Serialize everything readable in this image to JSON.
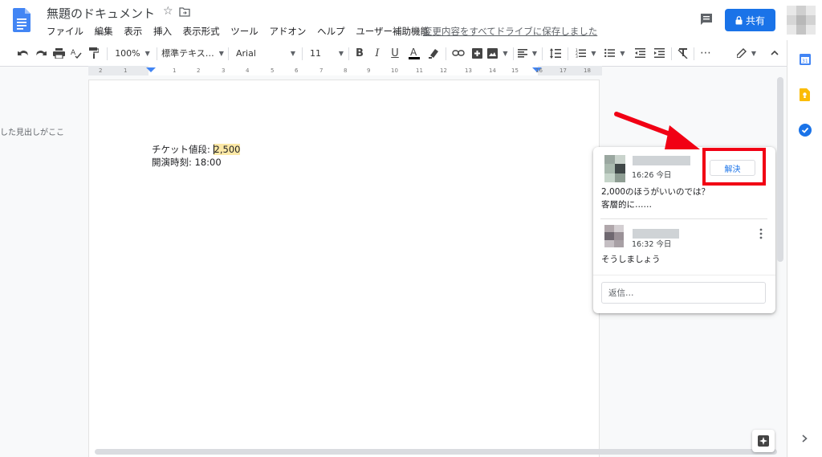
{
  "header": {
    "doc_title": "無題のドキュメント",
    "star_glyph": "☆",
    "menus": [
      "ファイル",
      "編集",
      "表示",
      "挿入",
      "表示形式",
      "ツール",
      "アドオン",
      "ヘルプ",
      "ユーザー補助機能"
    ],
    "save_status": "変更内容をすべてドライブに保存しました",
    "share_label": "共有"
  },
  "toolbar": {
    "zoom": "100%",
    "style": "標準テキス…",
    "font": "Arial",
    "size": "11",
    "more": "⋯"
  },
  "ruler": {
    "labels": [
      "2",
      "1",
      "1",
      "2",
      "3",
      "4",
      "5",
      "6",
      "7",
      "8",
      "9",
      "10",
      "11",
      "12",
      "13",
      "14",
      "15",
      "16",
      "17",
      "18"
    ]
  },
  "outline": {
    "text": "した見出しがここ"
  },
  "document": {
    "line1_label": "チケット値段: ",
    "line1_value": "2,500",
    "line2": "開演時刻: 18:00"
  },
  "comment": {
    "first": {
      "time": "16:26 今日",
      "text_line1": "2,000のほうがいいのでは？",
      "text_line2": "客層的に……"
    },
    "resolve_label": "解決",
    "reply": {
      "time": "16:32 今日",
      "text": "そうしましょう"
    },
    "reply_placeholder": "返信…"
  },
  "colors": {
    "accent": "#1a73e8",
    "highlight": "#fce8a6",
    "annotation_red": "#f10014"
  },
  "icons": [
    "docs-logo",
    "star-icon",
    "folder-move-icon",
    "comments-icon",
    "lock-icon",
    "undo-icon",
    "redo-icon",
    "print-icon",
    "spellcheck-icon",
    "paint-format-icon",
    "bold-icon",
    "italic-icon",
    "underline-icon",
    "text-color-icon",
    "highlight-icon",
    "link-icon",
    "add-comment-icon",
    "image-icon",
    "align-icon",
    "line-spacing-icon",
    "numbered-list-icon",
    "bulleted-list-icon",
    "indent-decrease-icon",
    "indent-increase-icon",
    "clear-format-icon",
    "editing-mode-icon",
    "chevron-up-icon",
    "calendar-icon",
    "keep-icon",
    "tasks-icon",
    "explore-icon",
    "chevron-right-icon",
    "more-vert-icon"
  ]
}
